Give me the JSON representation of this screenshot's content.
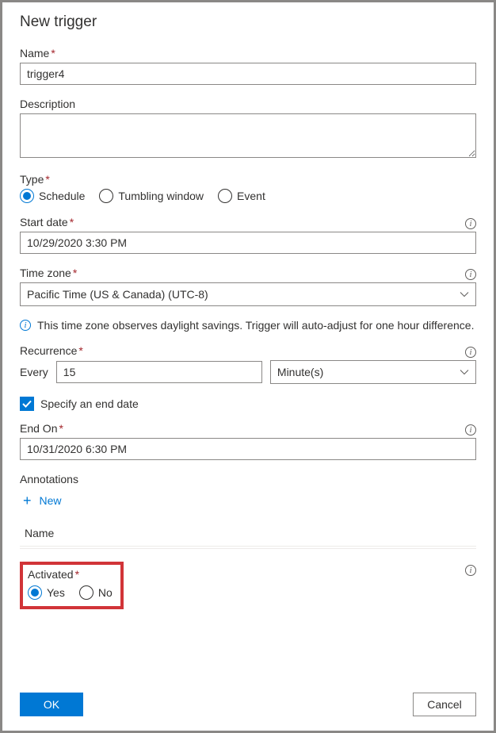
{
  "title": "New trigger",
  "fields": {
    "name": {
      "label": "Name",
      "value": "trigger4"
    },
    "description": {
      "label": "Description",
      "value": ""
    },
    "type": {
      "label": "Type",
      "options": [
        "Schedule",
        "Tumbling window",
        "Event"
      ],
      "selected": "Schedule"
    },
    "start_date": {
      "label": "Start date",
      "value": "10/29/2020 3:30 PM"
    },
    "time_zone": {
      "label": "Time zone",
      "value": "Pacific Time (US & Canada) (UTC-8)",
      "hint": "This time zone observes daylight savings. Trigger will auto-adjust for one hour difference."
    },
    "recurrence": {
      "label": "Recurrence",
      "every_label": "Every",
      "interval": "15",
      "unit": "Minute(s)"
    },
    "specify_end": {
      "label": "Specify an end date",
      "checked": true
    },
    "end_on": {
      "label": "End On",
      "value": "10/31/2020 6:30 PM"
    },
    "annotations": {
      "label": "Annotations",
      "new_label": "New",
      "column_header": "Name"
    },
    "activated": {
      "label": "Activated",
      "options": [
        "Yes",
        "No"
      ],
      "selected": "Yes"
    }
  },
  "footer": {
    "ok": "OK",
    "cancel": "Cancel"
  }
}
